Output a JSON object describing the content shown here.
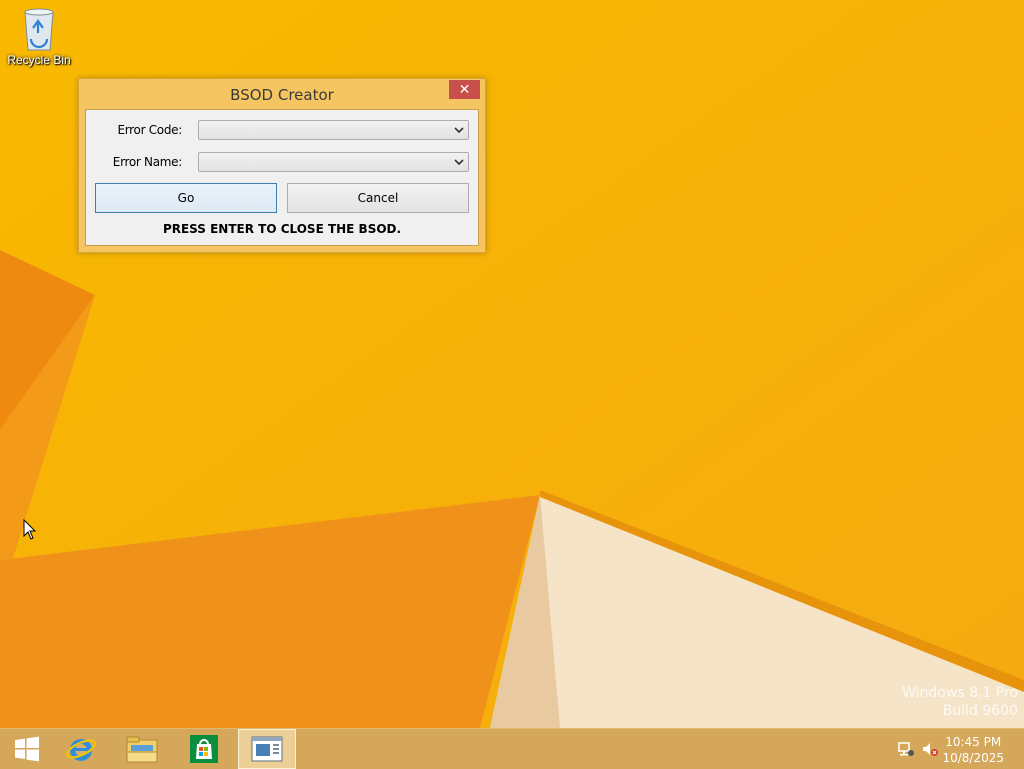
{
  "desktop": {
    "icons": [
      {
        "label": "Recycle Bin",
        "icon": "recycle-bin-icon"
      }
    ],
    "watermark": {
      "line1": "Windows 8.1 Pro",
      "line2": "Build 9600"
    }
  },
  "dialog": {
    "title": "BSOD Creator",
    "close_glyph": "✕",
    "error_code": {
      "label": "Error Code:",
      "value": ""
    },
    "error_name": {
      "label": "Error Name:",
      "value": ""
    },
    "go_label": "Go",
    "cancel_label": "Cancel",
    "message": "PRESS ENTER TO CLOSE THE BSOD."
  },
  "taskbar": {
    "items": [
      {
        "name": "start",
        "icon": "windows-logo-icon"
      },
      {
        "name": "internet-explorer",
        "icon": "internet-explorer-icon"
      },
      {
        "name": "file-explorer",
        "icon": "file-explorer-icon"
      },
      {
        "name": "store",
        "icon": "store-icon"
      },
      {
        "name": "bsod-creator",
        "icon": "app-window-icon",
        "active": true
      }
    ],
    "tray": {
      "network_icon": "network-icon",
      "volume_icon": "volume-muted-icon"
    },
    "clock": {
      "time": "10:45 PM",
      "date": "10/8/2025"
    }
  },
  "colors": {
    "accent": "#f7b100",
    "taskbar": "#d4a75a",
    "close": "#c7504b"
  }
}
